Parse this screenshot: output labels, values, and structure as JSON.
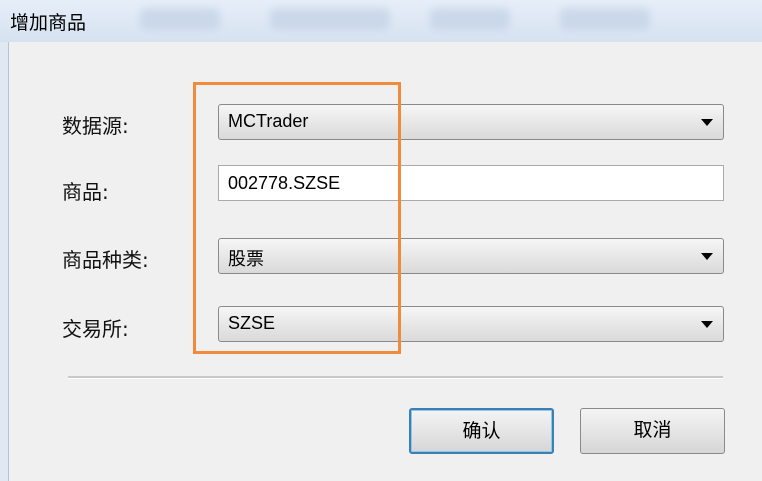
{
  "dialog": {
    "title": "增加商品"
  },
  "form": {
    "datasource": {
      "label": "数据源:",
      "value": "MCTrader"
    },
    "symbol": {
      "label": "商品:",
      "value": "002778.SZSE"
    },
    "category": {
      "label": "商品种类:",
      "value": "股票"
    },
    "exchange": {
      "label": "交易所:",
      "value": "SZSE"
    }
  },
  "buttons": {
    "ok_label": "确认",
    "cancel_label": "取消"
  },
  "colors": {
    "highlight_border": "#f08a3c",
    "default_button_border": "#3c7fb1"
  },
  "icons": {
    "dropdown": "chevron-down-icon"
  }
}
